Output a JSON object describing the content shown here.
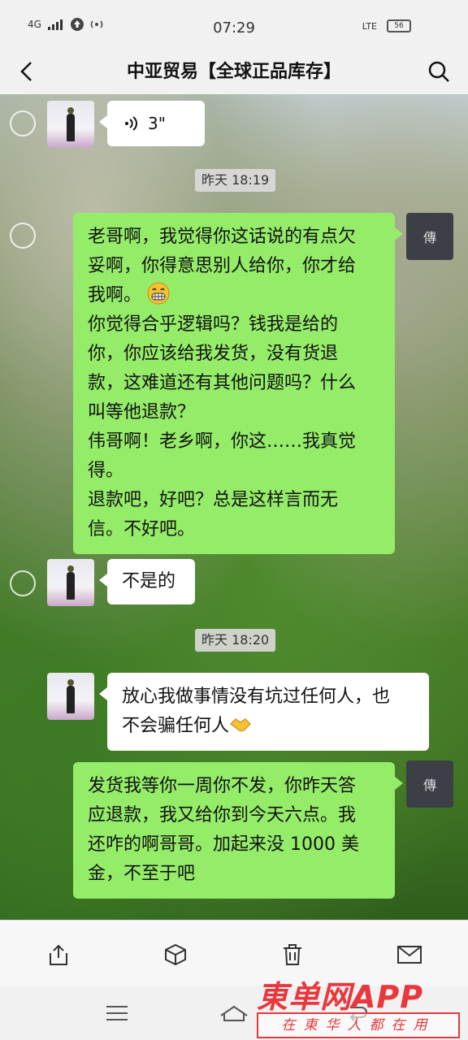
{
  "status_bar": {
    "network": "4G",
    "time": "07:29",
    "lte": "LTE",
    "battery": "56"
  },
  "header": {
    "title": "中亚贸易【全球正品库存】"
  },
  "messages": [
    {
      "side": "left",
      "type": "voice",
      "text": "3\""
    },
    {
      "type": "time",
      "text": "昨天 18:19"
    },
    {
      "side": "right",
      "type": "text",
      "lines": [
        "老哥啊，我觉得你这话说的有点欠",
        "妥啊，你得意思别人给你，你才给",
        "我啊。",
        "你觉得合乎逻辑吗？钱我是给的",
        "你，你应该给我发货，没有货退",
        "款，这难道还有其他问题吗？什么",
        "叫等他退款？",
        "伟哥啊！老乡啊，你这……我真觉",
        "得。",
        "退款吧，好吧？总是这样言而无",
        "信。不好吧。"
      ]
    },
    {
      "side": "left",
      "type": "text",
      "lines": [
        "不是的"
      ]
    },
    {
      "type": "time",
      "text": "昨天 18:20"
    },
    {
      "side": "left",
      "type": "text",
      "lines": [
        "放心我做事情没有坑过任何人，也",
        "不会骗任何人"
      ]
    },
    {
      "side": "right",
      "type": "text",
      "lines": [
        "发货我等你一周你不发，你昨天答",
        "应退款，我又给你到今天六点。我",
        "还咋的啊哥哥。加起来没 1000 美",
        "金，不至于吧"
      ]
    }
  ],
  "avatar_right_text": "傳",
  "toolbar": {
    "icons": [
      "share-icon",
      "box-icon",
      "trash-icon",
      "mail-icon"
    ]
  },
  "watermark": {
    "title": "東单网APP",
    "subtitle": "在東华人都在用"
  }
}
